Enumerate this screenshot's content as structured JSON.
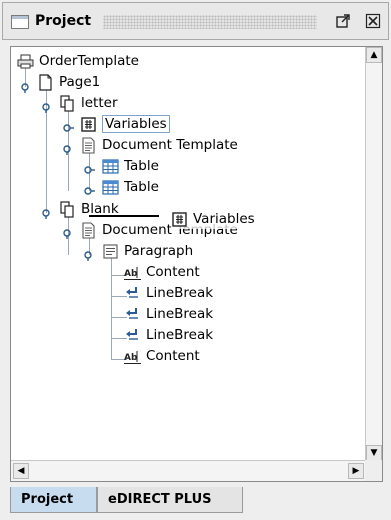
{
  "window": {
    "title": "Project",
    "maximize_icon": "maximize-icon",
    "close_icon": "close-icon"
  },
  "tree": {
    "nodes": [
      {
        "label": "OrderTemplate",
        "icon": "printer-icon"
      },
      {
        "label": "Page1",
        "icon": "page-icon"
      },
      {
        "label": "letter",
        "icon": "pages-icon"
      },
      {
        "label": "Variables",
        "icon": "variables-icon",
        "selected": true
      },
      {
        "label": "Document Template",
        "icon": "document-template-icon"
      },
      {
        "label": "Table",
        "icon": "table-icon"
      },
      {
        "label": "Table",
        "icon": "table-icon"
      },
      {
        "label": "Blank",
        "icon": "pages-icon"
      },
      {
        "label": "Document Template",
        "icon": "document-template-icon"
      },
      {
        "label": "Paragraph",
        "icon": "paragraph-icon"
      },
      {
        "label": "Content",
        "icon": "text-content-icon"
      },
      {
        "label": "LineBreak",
        "icon": "linebreak-icon"
      },
      {
        "label": "LineBreak",
        "icon": "linebreak-icon"
      },
      {
        "label": "LineBreak",
        "icon": "linebreak-icon"
      },
      {
        "label": "Content",
        "icon": "text-content-icon"
      }
    ],
    "drag_ghost": {
      "label": "Variables",
      "icon": "variables-icon"
    }
  },
  "tabs": [
    {
      "label": "Project",
      "active": true
    },
    {
      "label": "eDIRECT PLUS",
      "active": false
    }
  ],
  "colors": {
    "selection_border": "#7da2ce",
    "tree_lines": "#9aa8b8",
    "tab_active": "#c8dcf0"
  }
}
